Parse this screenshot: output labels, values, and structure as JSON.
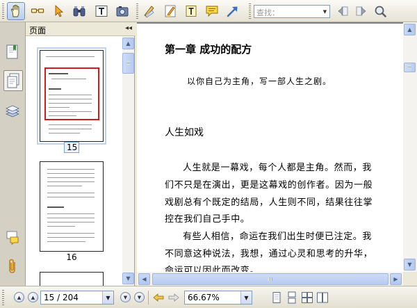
{
  "toolbar": {
    "tools": [
      {
        "name": "hand-tool",
        "active": true
      },
      {
        "name": "select-text-tool"
      },
      {
        "name": "select-tool"
      },
      {
        "name": "snapshot-tool"
      },
      {
        "name": "typewriter-tool"
      },
      {
        "name": "camera-tool"
      },
      {
        "name": "edit-tool"
      },
      {
        "name": "highlight-tool"
      },
      {
        "name": "text-tool"
      },
      {
        "name": "note-tool"
      },
      {
        "name": "arrow-tool"
      }
    ],
    "search": {
      "placeholder": "查找："
    }
  },
  "left_strip": {
    "items": [
      {
        "name": "bookmarks-tab"
      },
      {
        "name": "pages-tab",
        "active": true
      },
      {
        "name": "layers-tab"
      },
      {
        "name": "comments-tab"
      },
      {
        "name": "attachments-tab"
      }
    ]
  },
  "pages_panel": {
    "title": "页面",
    "collapse_glyph": "◂◂",
    "thumbnails": [
      {
        "label": "15",
        "selected": true
      },
      {
        "label": "16",
        "selected": false
      }
    ]
  },
  "document": {
    "chapter_title": "第一章  成功的配方",
    "epigraph": "以你自己为主角，写一部人生之剧。",
    "section_title": "人生如戏",
    "paragraph_lines": [
      "人生就是一幕戏，每个人都是主角。然而，我",
      "们不只是在演出，更是这幕戏的创作者。因为一般",
      "戏剧总有个既定的结局，人生则不同，结果往往掌",
      "控在我们自己手中。",
      "有些人相信，命运在我们出生时便已注定。我",
      "不同意这种说法，我想，通过心灵和思考的升华，",
      "命运可以因此而改变。"
    ]
  },
  "statusbar": {
    "page_field": "15 / 204",
    "zoom_field": "66.67%",
    "view_buttons": [
      "single-page",
      "continuous",
      "facing",
      "continuous-facing"
    ]
  }
}
